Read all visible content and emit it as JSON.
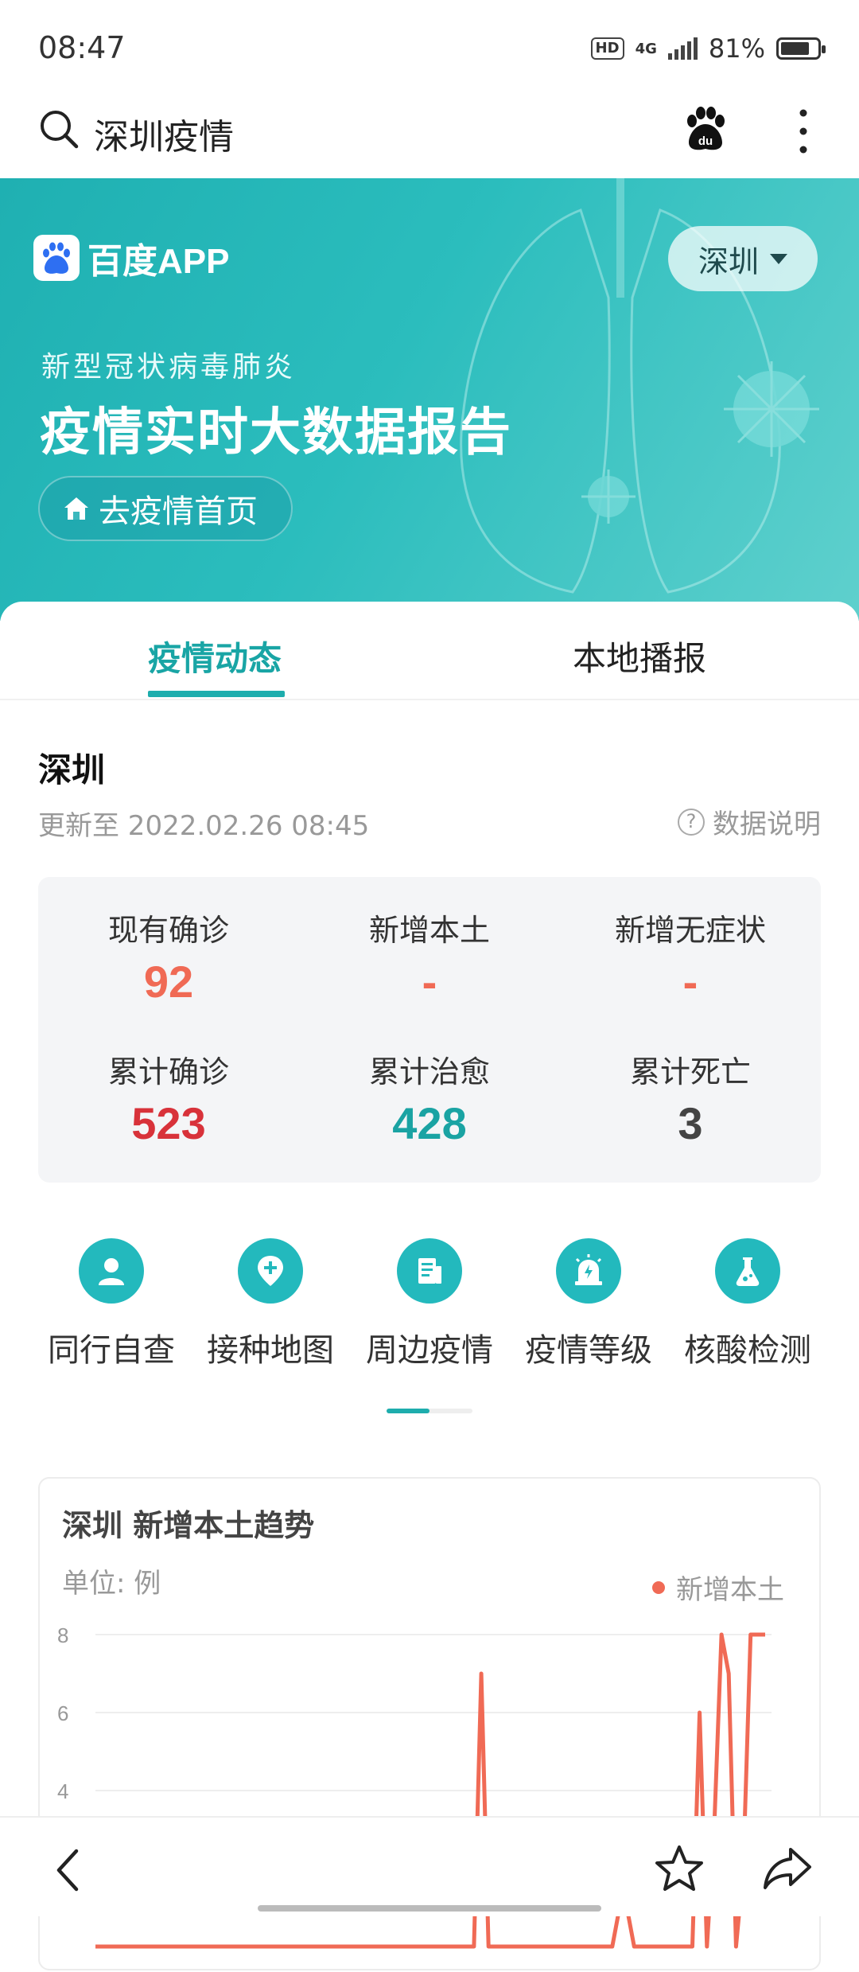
{
  "status_bar": {
    "time": "08:47",
    "network": "4G",
    "hd": "HD",
    "battery": "81%"
  },
  "search": {
    "query": "深圳疫情"
  },
  "banner": {
    "logo_text": "百度APP",
    "city": "深圳",
    "subtitle": "新型冠状病毒肺炎",
    "title": "疫情实时大数据报告",
    "home_button": "去疫情首页"
  },
  "tabs": [
    {
      "label": "疫情动态",
      "active": true
    },
    {
      "label": "本地播报",
      "active": false
    }
  ],
  "region": {
    "name": "深圳",
    "updated": "更新至 2022.02.26 08:45",
    "data_note": "数据说明"
  },
  "stats": [
    {
      "label": "现有确诊",
      "value": "92",
      "color": "#f06a55"
    },
    {
      "label": "新增本土",
      "value": "-",
      "color": "#f06a55"
    },
    {
      "label": "新增无症状",
      "value": "-",
      "color": "#f06a55"
    },
    {
      "label": "累计确诊",
      "value": "523",
      "color": "#d8323a"
    },
    {
      "label": "累计治愈",
      "value": "428",
      "color": "#1aa3a3"
    },
    {
      "label": "累计死亡",
      "value": "3",
      "color": "#444444"
    }
  ],
  "quick_links": [
    {
      "label": "同行自查",
      "icon": "person-icon"
    },
    {
      "label": "接种地图",
      "icon": "map-pin-plus-icon"
    },
    {
      "label": "周边疫情",
      "icon": "document-icon"
    },
    {
      "label": "疫情等级",
      "icon": "alarm-icon"
    },
    {
      "label": "核酸检测",
      "icon": "flask-icon"
    }
  ],
  "chart_data": {
    "type": "line",
    "title": "深圳 新增本土趋势",
    "unit_label": "单位: 例",
    "legend": [
      "新增本土"
    ],
    "yticks": [
      "8",
      "6",
      "4"
    ],
    "ylim": [
      0,
      8
    ],
    "series": [
      {
        "name": "新增本土",
        "color": "#f06a55",
        "values": [
          0,
          0,
          0,
          0,
          0,
          0,
          0,
          0,
          0,
          0,
          0,
          0,
          0,
          0,
          0,
          0,
          0,
          0,
          0,
          0,
          0,
          0,
          0,
          0,
          0,
          0,
          0,
          0,
          0,
          0,
          0,
          0,
          0,
          0,
          0,
          0,
          0,
          0,
          0,
          0,
          0,
          0,
          0,
          0,
          0,
          0,
          0,
          0,
          0,
          0,
          0,
          0,
          0,
          7,
          0,
          0,
          0,
          0,
          0,
          0,
          0,
          0,
          0,
          0,
          0,
          0,
          0,
          0,
          0,
          0,
          0,
          0,
          1,
          1,
          0,
          0,
          0,
          0,
          0,
          0,
          0,
          0,
          0,
          6,
          0,
          3,
          8,
          7,
          0,
          2,
          8,
          8,
          8
        ]
      }
    ]
  },
  "bottom_bar": {
    "icons": [
      "back-icon",
      "star-icon",
      "share-icon"
    ]
  }
}
